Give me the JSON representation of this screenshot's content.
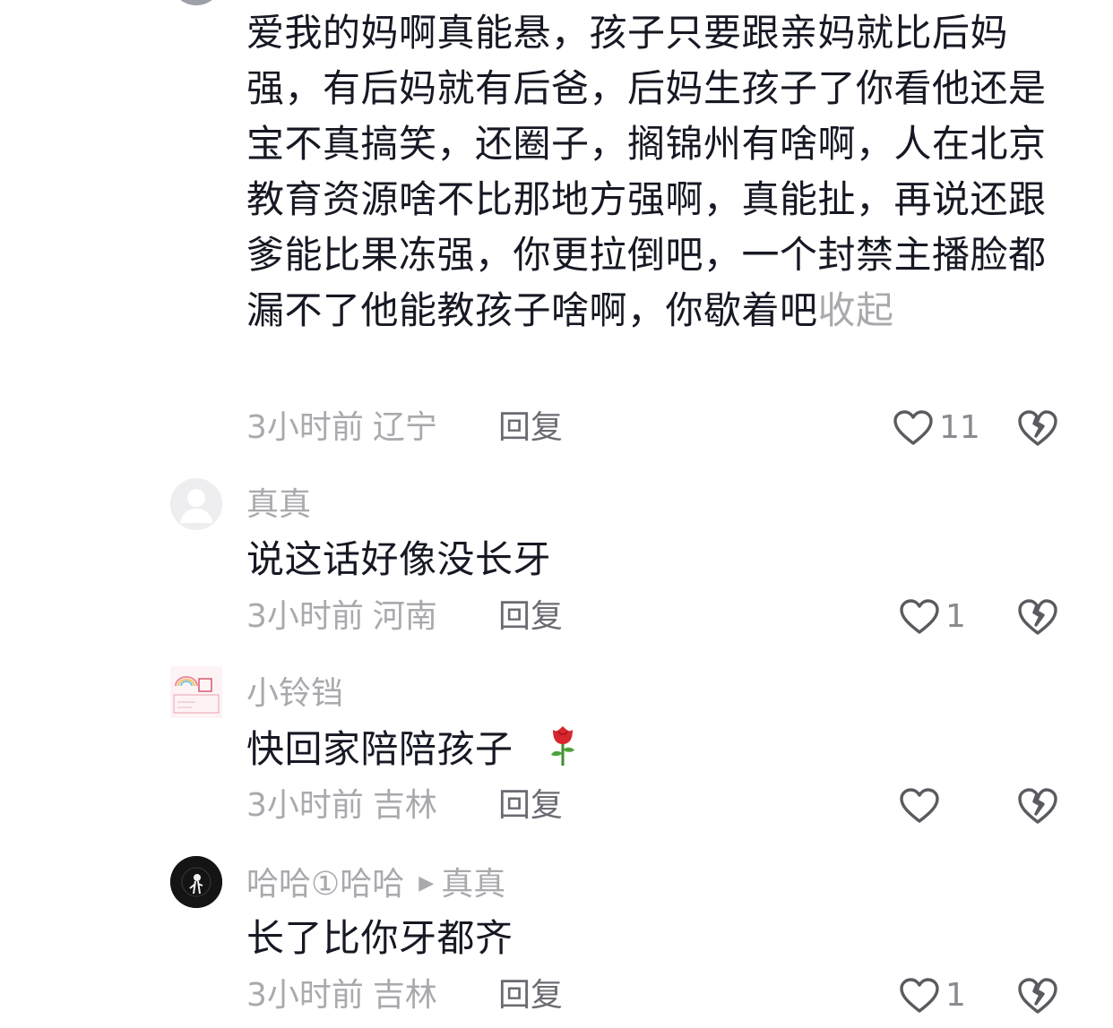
{
  "comments": [
    {
      "text": "爱我的妈啊真能悬，孩子只要跟亲妈就比后妈强，有后妈就有后爸，后妈生孩子了你看他还是宝不真搞笑，还圈子，搁锦州有啥啊，人在北京教育资源啥不比那地方强啊，真能扯，再说还跟爹能比果冻强，你更拉倒吧，一个封禁主播脸都漏不了他能教孩子啥啊，你歇着吧",
      "collapse_label": "收起",
      "time": "3小时前",
      "location": "辽宁",
      "reply_label": "回复",
      "likes": "11"
    },
    {
      "author": "真真",
      "text": "说这话好像没长牙",
      "time": "3小时前",
      "location": "河南",
      "reply_label": "回复",
      "likes": "1"
    },
    {
      "author": "小铃铛",
      "text": "快回家陪陪孩子",
      "emoji": "rose",
      "time": "3小时前",
      "location": "吉林",
      "reply_label": "回复",
      "likes": ""
    },
    {
      "author": "哈哈①哈哈",
      "reply_to": "真真",
      "text": "长了比你牙都齐",
      "time": "3小时前",
      "location": "吉林",
      "reply_label": "回复",
      "likes": "1"
    }
  ],
  "icons": {
    "like": "heart-outline-icon",
    "dislike": "broken-heart-icon",
    "reply_arrow": "triangle-right-icon"
  },
  "colors": {
    "text": "#161823",
    "muted": "#a9a9ae",
    "icon": "#5a5a60"
  }
}
